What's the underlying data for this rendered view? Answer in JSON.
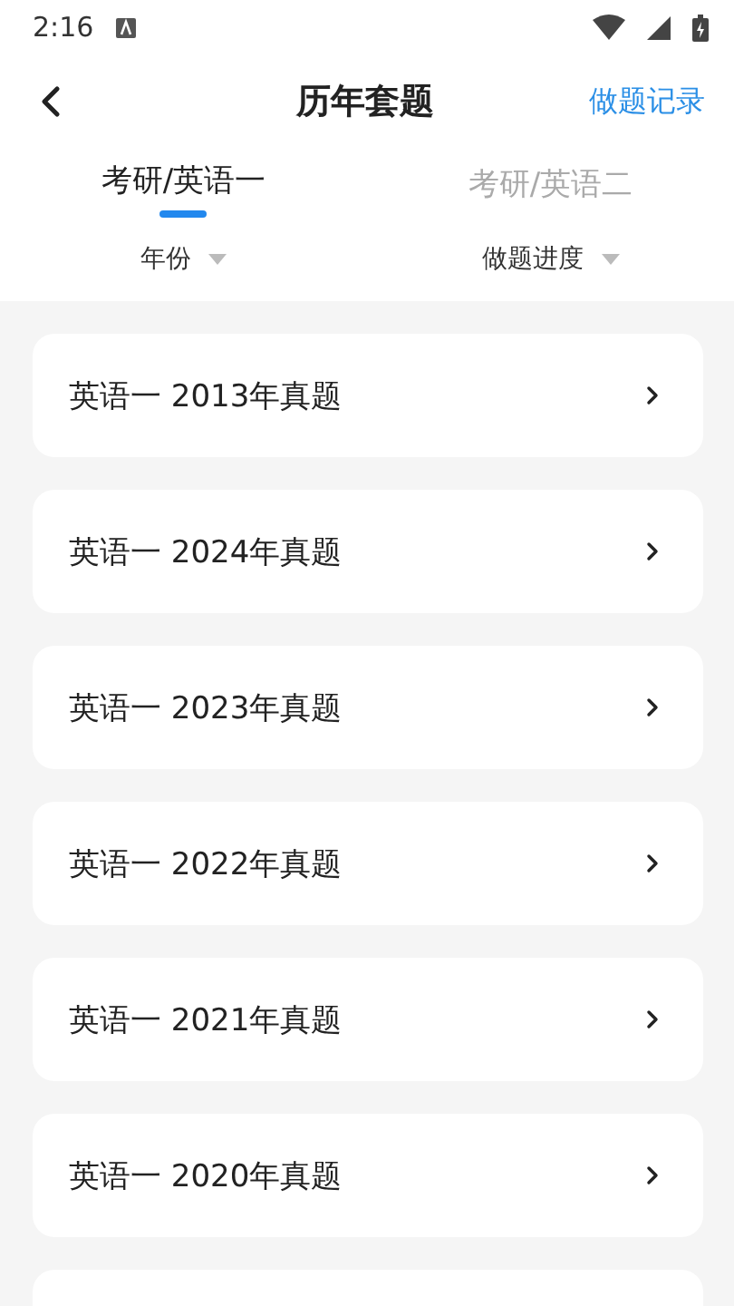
{
  "status_bar": {
    "time": "2:16"
  },
  "header": {
    "title": "历年套题",
    "action": "做题记录"
  },
  "tabs": [
    {
      "label": "考研/英语一",
      "selected": true
    },
    {
      "label": "考研/英语二",
      "selected": false
    }
  ],
  "filters": [
    {
      "label": "年份"
    },
    {
      "label": "做题进度"
    }
  ],
  "papers": [
    {
      "kind": "row",
      "title": "英语一 2013年真题"
    },
    {
      "kind": "row",
      "title": "英语一 2024年真题"
    },
    {
      "kind": "row",
      "title": "英语一 2023年真题"
    },
    {
      "kind": "row",
      "title": "英语一 2022年真题"
    },
    {
      "kind": "row",
      "title": "英语一 2021年真题"
    },
    {
      "kind": "row",
      "title": "英语一 2020年真题"
    },
    {
      "kind": "blank"
    }
  ]
}
